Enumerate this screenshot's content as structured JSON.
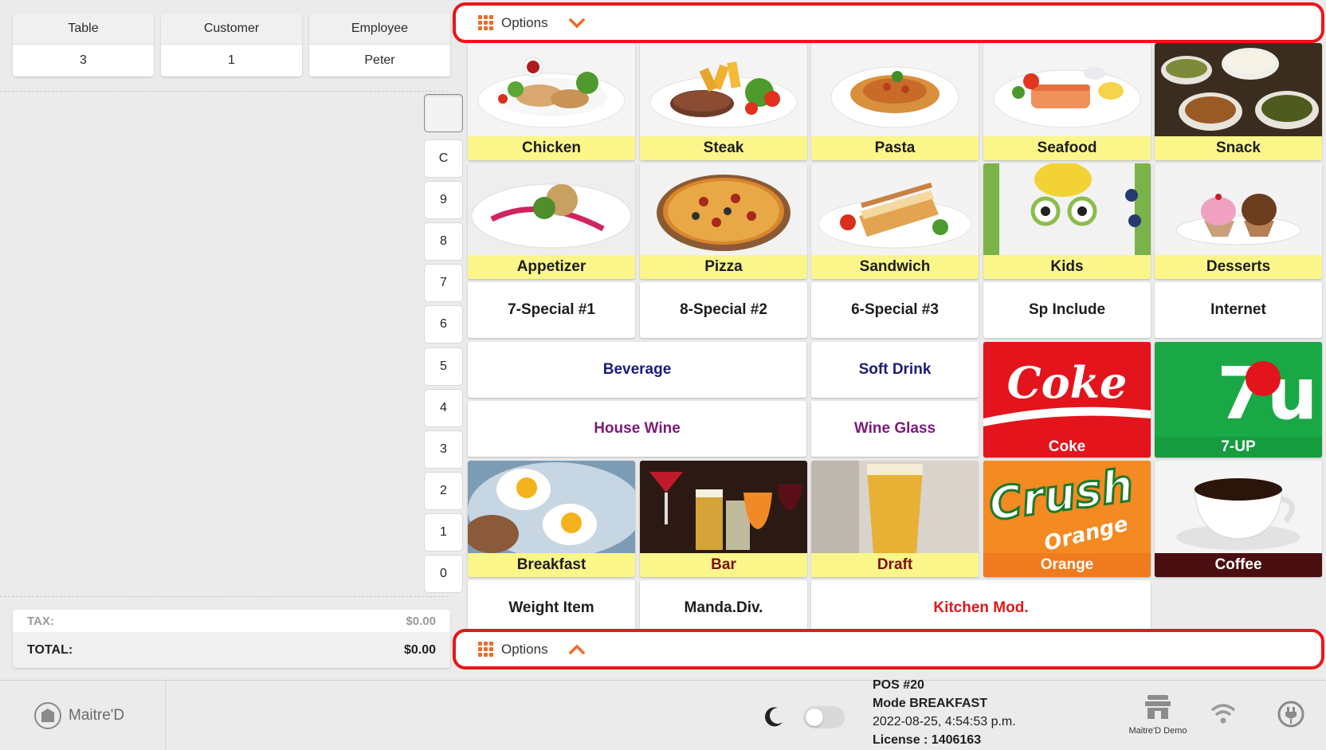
{
  "header_cards": [
    {
      "label": "Table",
      "value": "3"
    },
    {
      "label": "Customer",
      "value": "1"
    },
    {
      "label": "Employee",
      "value": "Peter"
    }
  ],
  "numpad": [
    "C",
    "9",
    "8",
    "7",
    "6",
    "5",
    "4",
    "3",
    "2",
    "1",
    "0"
  ],
  "totals": {
    "tax_label": "TAX:",
    "tax_value": "$0.00",
    "total_label": "TOTAL:",
    "total_value": "$0.00"
  },
  "options": {
    "top_label": "Options",
    "bottom_label": "Options"
  },
  "tiles": {
    "chicken": "Chicken",
    "steak": "Steak",
    "pasta": "Pasta",
    "seafood": "Seafood",
    "snack": "Snack",
    "appetizer": "Appetizer",
    "pizza": "Pizza",
    "sandwich": "Sandwich",
    "kids": "Kids",
    "desserts": "Desserts",
    "special1": "7-Special #1",
    "special2": "8-Special #2",
    "special3": "6-Special #3",
    "sp_include": "Sp Include",
    "internet": "Internet",
    "beverage": "Beverage",
    "soft_drink": "Soft Drink",
    "coke": "Coke",
    "sevenup": "7-UP",
    "house_wine": "House Wine",
    "wine_glass": "Wine Glass",
    "breakfast": "Breakfast",
    "bar": "Bar",
    "draft": "Draft",
    "orange": "Orange",
    "coffee": "Coffee",
    "weight_item": "Weight Item",
    "manda_div": "Manda.Div.",
    "kitchen_mod": "Kitchen Mod."
  },
  "brand_art": {
    "coke_logo": "Coke",
    "sevenup_logo": "7up",
    "crush_logo": "Crush",
    "crush_sub": "Orange"
  },
  "status": {
    "logo": "Maitre'D",
    "pos": "POS #20",
    "mode": "Mode BREAKFAST",
    "datetime": "2022-08-25, 4:54:53 p.m.",
    "license": "License : 1406163",
    "demo_label": "Maitre'D Demo"
  },
  "colors": {
    "accent": "#e8161b",
    "option_icon": "#f06a2a",
    "caption_yellow": "#fbf68a"
  }
}
